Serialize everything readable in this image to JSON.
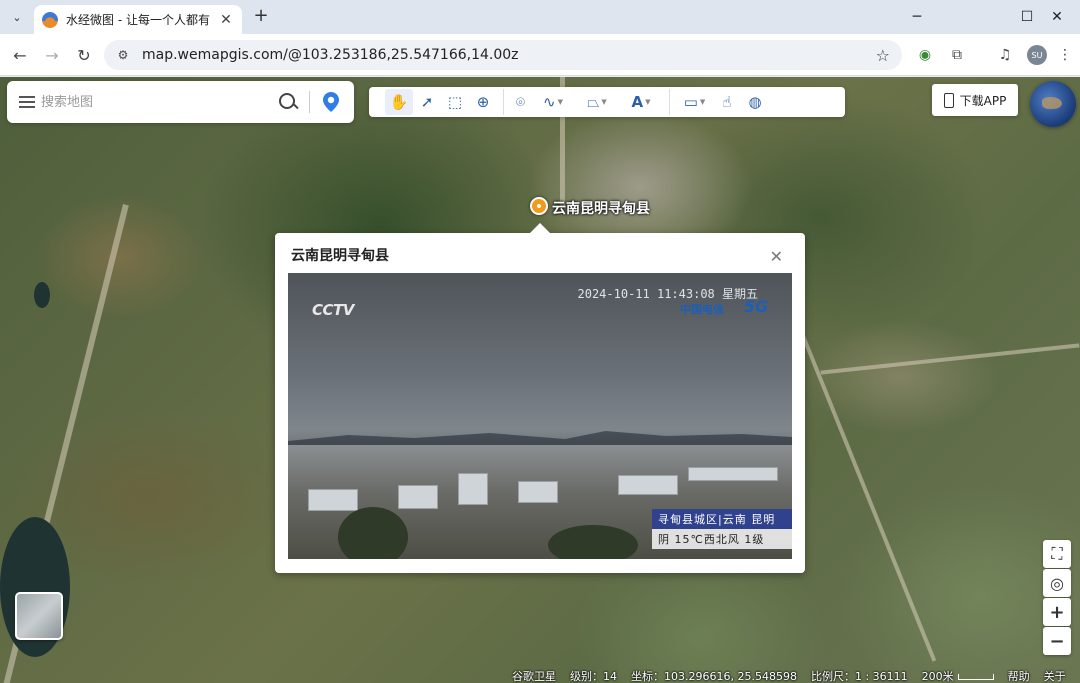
{
  "browser": {
    "tab_title": "水经微图 - 让每一个人都有自己的地图",
    "url": "map.wemapgis.com/@103.253186,25.547166,14.00z",
    "avatar_text": "SU"
  },
  "search": {
    "placeholder": "搜索地图"
  },
  "toolbar": {
    "tools": [
      "pan-hand",
      "select-pointer",
      "box-select",
      "zoom-box",
      "place-pin",
      "draw-line",
      "draw-polygon",
      "text-tool",
      "measure-ruler",
      "click-query",
      "globe-view"
    ]
  },
  "download": {
    "label": "下载APP"
  },
  "marker": {
    "label": "云南昆明寻甸县"
  },
  "popup": {
    "title": "云南昆明寻甸县",
    "video": {
      "logo": "CCTV",
      "timestamp": "2024-10-11  11:43:08  星期五",
      "operator": "中国电信",
      "network": "5G",
      "caption_line1": "寻甸县城区|云南 昆明",
      "caption_line2": "阴 15℃西北风 1级"
    }
  },
  "status": {
    "source": "谷歌卫星",
    "level_label": "级别：",
    "level": "14",
    "coord_label": "坐标：",
    "coords": "103.296616, 25.548598",
    "scale_label": "比例尺：",
    "scale": "1 : 36111",
    "scale_distance": "200米",
    "help": "帮助",
    "about": "关于"
  },
  "colors": {
    "accent": "#2d5fa8",
    "marker": "#f39a1a",
    "telecom_blue": "#1c5fb8"
  }
}
